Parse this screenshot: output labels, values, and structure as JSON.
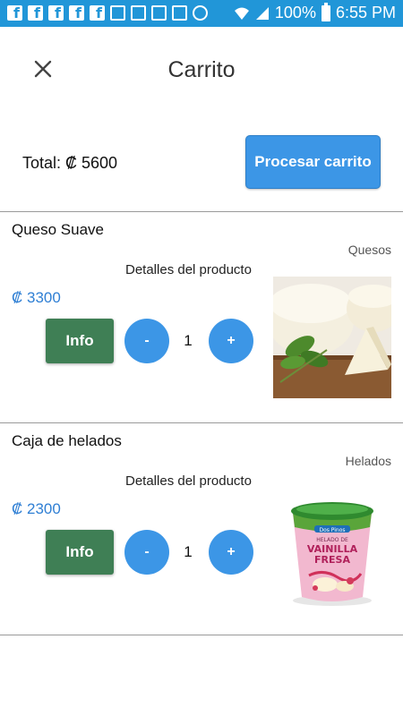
{
  "status_bar": {
    "notification_icons": [
      "facebook-icon",
      "facebook-icon",
      "facebook-icon",
      "facebook-icon",
      "facebook-icon",
      "video-icon",
      "message-icon",
      "image-icon",
      "cast-icon",
      "sync-icon"
    ],
    "battery": "100%",
    "time": "6:55 PM"
  },
  "app_bar": {
    "title": "Carrito",
    "close_icon": "close-icon"
  },
  "cart": {
    "total_label": "Total: ₡ 5600",
    "process_label": "Procesar carrito"
  },
  "products": [
    {
      "name": "Queso Suave",
      "category": "Quesos",
      "details_label": "Detalles del producto",
      "price": "₡ 3300",
      "info_label": "Info",
      "minus_label": "-",
      "quantity": "1",
      "plus_label": "+",
      "image": "cheese-image"
    },
    {
      "name": "Caja de helados",
      "category": "Helados",
      "details_label": "Detalles del producto",
      "price": "₡ 2300",
      "info_label": "Info",
      "minus_label": "-",
      "quantity": "1",
      "plus_label": "+",
      "image": "ice-cream-tub-image",
      "image_text": {
        "brand": "Dos Pinos",
        "line1": "HELADO DE",
        "line2": "VAINILLA",
        "line3": "FRESA"
      }
    }
  ],
  "colors": {
    "status_bar": "#2196d8",
    "primary_button": "#3c96e6",
    "info_button": "#3f7f55",
    "price_text": "#2f7fd4"
  }
}
